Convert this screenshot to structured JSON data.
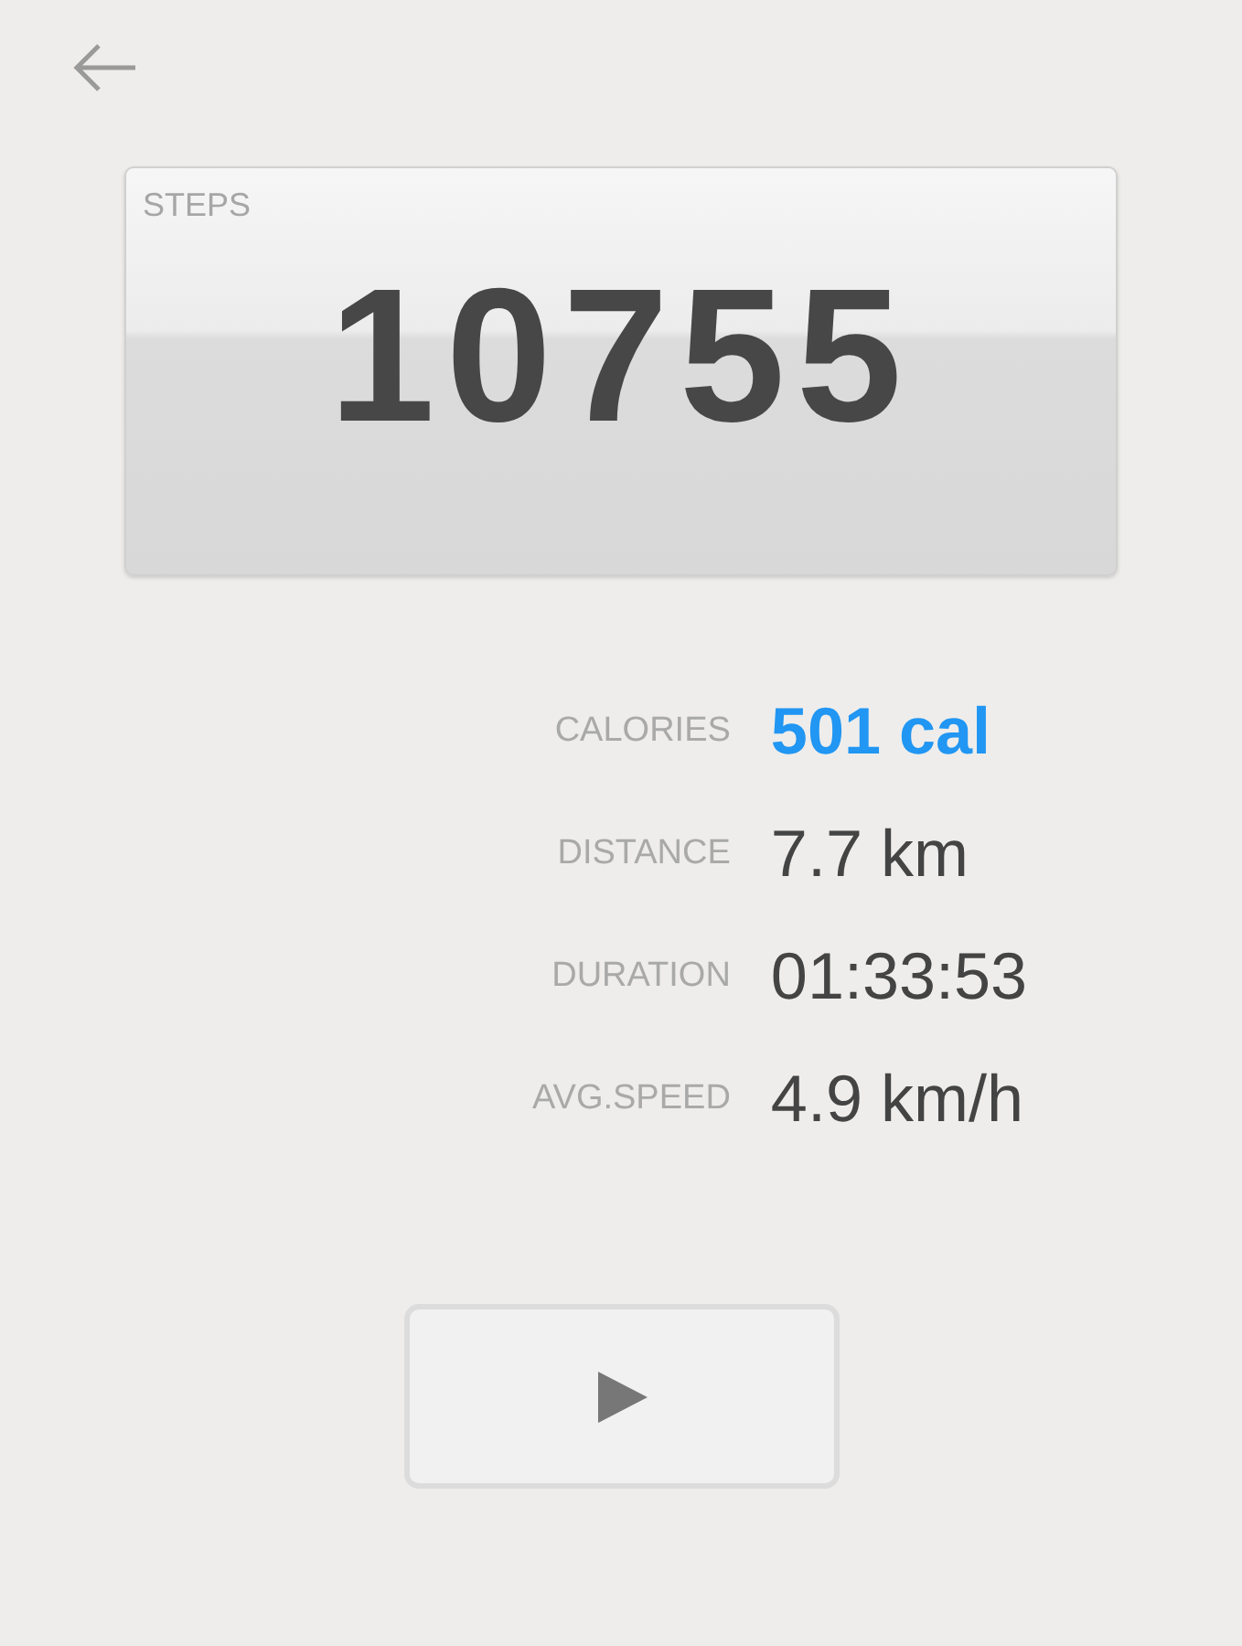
{
  "steps": {
    "label": "STEPS",
    "value": "10755"
  },
  "stats": [
    {
      "label": "CALORIES",
      "value": "501 cal",
      "highlighted": true
    },
    {
      "label": "DISTANCE",
      "value": "7.7 km",
      "highlighted": false
    },
    {
      "label": "DURATION",
      "value": "01:33:53",
      "highlighted": false
    },
    {
      "label": "AVG.SPEED",
      "value": "4.9 km/h",
      "highlighted": false
    }
  ]
}
